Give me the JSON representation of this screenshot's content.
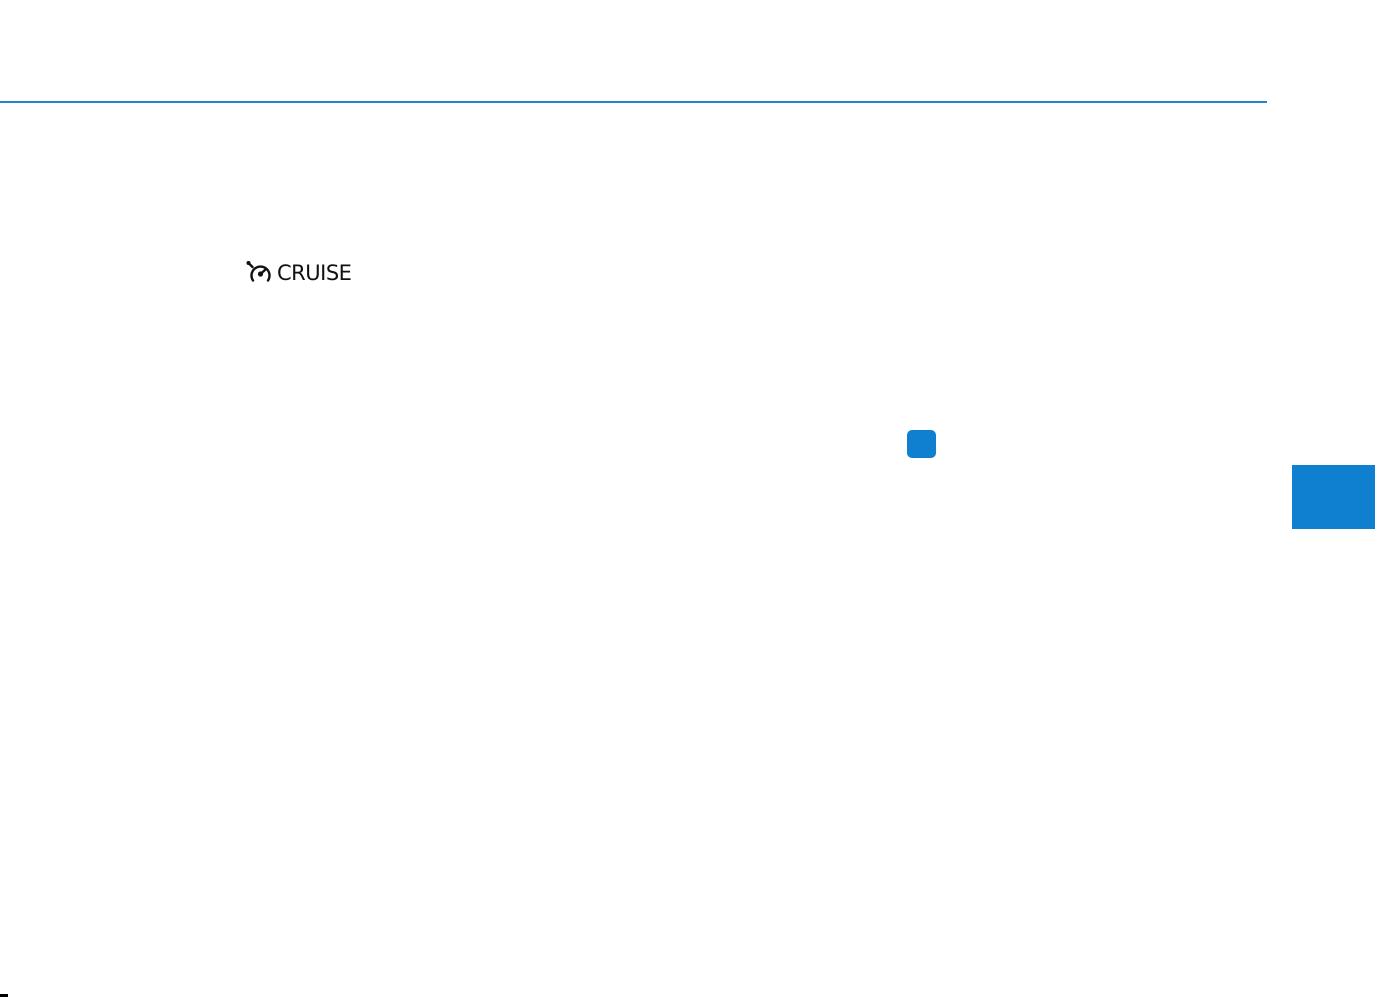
{
  "indicator": {
    "label": "CRUISE",
    "icon": "cruise-speedometer-icon"
  },
  "colors": {
    "accent": "#1f86cf",
    "marker": "#0f7fd0",
    "tab": "#0f7fd0"
  }
}
